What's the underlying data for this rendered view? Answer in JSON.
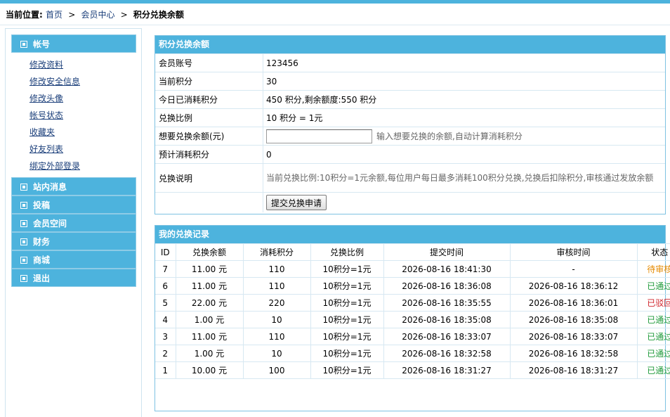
{
  "breadcrumb": {
    "prefix": "当前位置:",
    "home": "首页",
    "member_center": "会员中心",
    "current": "积分兑换余额",
    "separator": ">"
  },
  "sidebar": {
    "sections": [
      {
        "label": "帐号"
      },
      {
        "label": "站内消息"
      },
      {
        "label": "投稿"
      },
      {
        "label": "会员空间"
      },
      {
        "label": "财务"
      },
      {
        "label": "商城"
      },
      {
        "label": "退出"
      }
    ],
    "account_links": [
      "修改资料",
      "修改安全信息",
      "修改头像",
      "帐号状态",
      "收藏夹",
      "好友列表",
      "绑定外部登录"
    ]
  },
  "exchange_form": {
    "title": "积分兑换余额",
    "rows": {
      "account": {
        "label": "会员账号",
        "value": "123456"
      },
      "points": {
        "label": "当前积分",
        "value": "30"
      },
      "today": {
        "label": "今日已消耗积分",
        "value": "450 积分,剩余额度:550 积分"
      },
      "ratio": {
        "label": "兑换比例",
        "value": "10 积分 = 1元"
      },
      "amount": {
        "label": "想要兑换余额(元)",
        "value": "",
        "placeholder": "",
        "hint": "输入想要兑换的余额,自动计算消耗积分"
      },
      "estimate": {
        "label": "预计消耗积分",
        "value": "0"
      },
      "note": {
        "label": "兑换说明",
        "value": "当前兑换比例:10积分=1元余额,每位用户每日最多消耗100积分兑换,兑换后扣除积分,审核通过发放余额"
      }
    },
    "submit_label": "提交兑换申请"
  },
  "records": {
    "title": "我的兑换记录",
    "columns": [
      "ID",
      "兑换余额",
      "消耗积分",
      "兑换比例",
      "提交时间",
      "审核时间",
      "状态"
    ],
    "rows": [
      {
        "id": "7",
        "amount": "11.00 元",
        "points": "110",
        "ratio": "10积分=1元",
        "submitted": "2026-08-16 18:41:30",
        "reviewed": "-",
        "status": "待审核",
        "status_type": "pending"
      },
      {
        "id": "6",
        "amount": "11.00 元",
        "points": "110",
        "ratio": "10积分=1元",
        "submitted": "2026-08-16 18:36:08",
        "reviewed": "2026-08-16 18:36:12",
        "status": "已通过",
        "status_type": "pass"
      },
      {
        "id": "5",
        "amount": "22.00 元",
        "points": "220",
        "ratio": "10积分=1元",
        "submitted": "2026-08-16 18:35:55",
        "reviewed": "2026-08-16 18:36:01",
        "status": "已驳回",
        "status_type": "reject"
      },
      {
        "id": "4",
        "amount": "1.00 元",
        "points": "10",
        "ratio": "10积分=1元",
        "submitted": "2026-08-16 18:35:08",
        "reviewed": "2026-08-16 18:35:08",
        "status": "已通过",
        "status_type": "pass"
      },
      {
        "id": "3",
        "amount": "11.00 元",
        "points": "110",
        "ratio": "10积分=1元",
        "submitted": "2026-08-16 18:33:07",
        "reviewed": "2026-08-16 18:33:07",
        "status": "已通过",
        "status_type": "pass"
      },
      {
        "id": "2",
        "amount": "1.00 元",
        "points": "10",
        "ratio": "10积分=1元",
        "submitted": "2026-08-16 18:32:58",
        "reviewed": "2026-08-16 18:32:58",
        "status": "已通过",
        "status_type": "pass"
      },
      {
        "id": "1",
        "amount": "10.00 元",
        "points": "100",
        "ratio": "10积分=1元",
        "submitted": "2026-08-16 18:31:27",
        "reviewed": "2026-08-16 18:31:27",
        "status": "已通过",
        "status_type": "pass"
      }
    ]
  },
  "colors": {
    "accent": "#4db3dd",
    "link": "#1a3e7a",
    "pending": "#e58a00",
    "pass": "#1e9a39",
    "reject": "#d0252c"
  }
}
